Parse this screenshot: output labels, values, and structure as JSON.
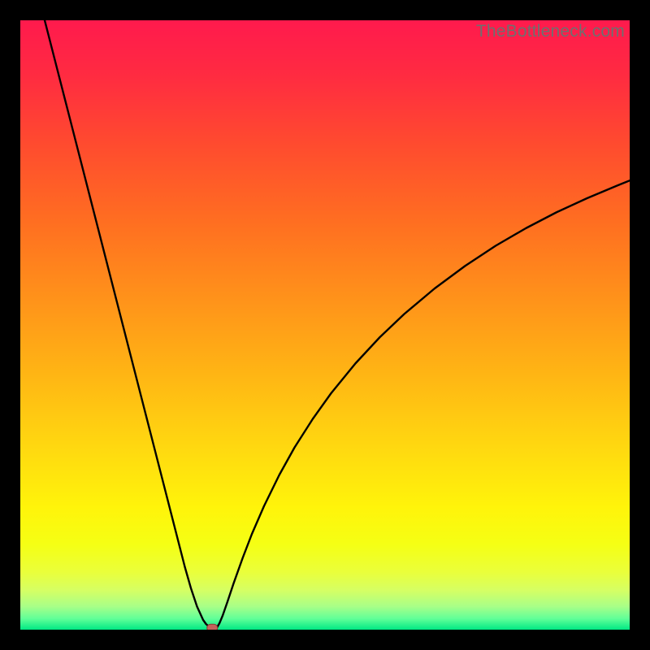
{
  "watermark": "TheBottleneck.com",
  "colors": {
    "gradient_stops": [
      {
        "pct": 0.0,
        "color": "#ff1a4d"
      },
      {
        "pct": 0.09,
        "color": "#ff2b41"
      },
      {
        "pct": 0.2,
        "color": "#ff4a2f"
      },
      {
        "pct": 0.33,
        "color": "#ff6e21"
      },
      {
        "pct": 0.46,
        "color": "#ff931a"
      },
      {
        "pct": 0.58,
        "color": "#ffb514"
      },
      {
        "pct": 0.7,
        "color": "#ffd810"
      },
      {
        "pct": 0.8,
        "color": "#fff40a"
      },
      {
        "pct": 0.86,
        "color": "#f5ff14"
      },
      {
        "pct": 0.905,
        "color": "#eaff3a"
      },
      {
        "pct": 0.935,
        "color": "#d6ff63"
      },
      {
        "pct": 0.962,
        "color": "#a8ff88"
      },
      {
        "pct": 0.982,
        "color": "#60ff98"
      },
      {
        "pct": 1.0,
        "color": "#00e884"
      }
    ],
    "curve": "#000000",
    "marker_fill": "#c4635b",
    "marker_stroke": "#8a3c36"
  },
  "chart_data": {
    "type": "line",
    "title": "",
    "xlabel": "",
    "ylabel": "",
    "xlim": [
      0,
      100
    ],
    "ylim": [
      0,
      100
    ],
    "x": [
      4,
      6,
      8,
      10,
      12,
      14,
      16,
      18,
      20,
      22,
      24,
      26,
      27,
      28,
      29,
      30,
      30.5,
      31,
      31.5,
      31.8,
      32,
      32.3,
      32.7,
      33.2,
      34,
      35,
      36.5,
      38,
      40,
      42.5,
      45,
      48,
      51,
      55,
      59,
      63,
      68,
      73,
      78,
      83,
      88,
      93,
      98,
      100
    ],
    "y": [
      100,
      92.2,
      84.4,
      76.6,
      68.8,
      61.0,
      53.2,
      45.4,
      37.6,
      29.8,
      22.0,
      14.2,
      10.3,
      6.8,
      3.8,
      1.6,
      0.9,
      0.5,
      0.25,
      0.15,
      0.18,
      0.4,
      1.1,
      2.3,
      4.6,
      7.6,
      11.8,
      15.7,
      20.3,
      25.4,
      29.9,
      34.6,
      38.8,
      43.7,
      48.0,
      51.8,
      56.0,
      59.7,
      63.0,
      65.9,
      68.5,
      70.8,
      72.9,
      73.7
    ],
    "marker": {
      "x": 31.5,
      "y": 0.3
    }
  }
}
